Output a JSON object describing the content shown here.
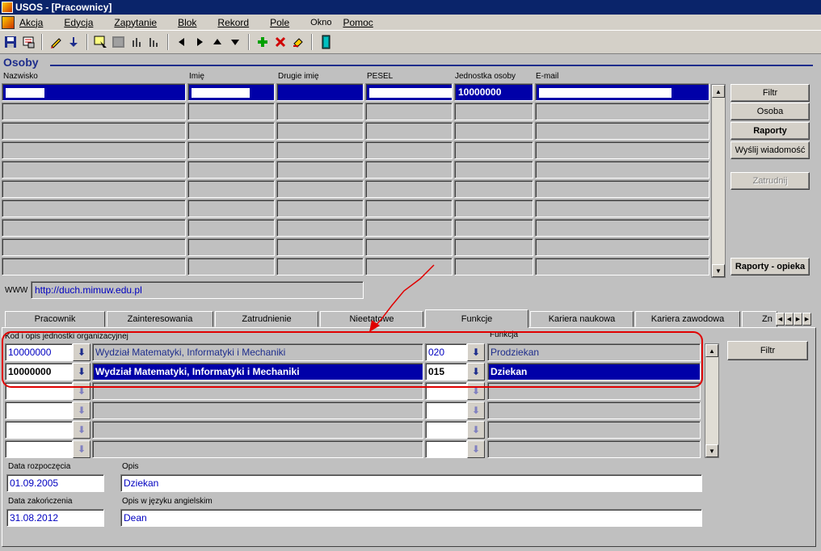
{
  "window": {
    "title": "USOS - [Pracownicy]"
  },
  "menu": [
    "Akcja",
    "Edycja",
    "Zapytanie",
    "Blok",
    "Rekord",
    "Pole",
    "Okno",
    "Pomoc"
  ],
  "toolbar_icons": [
    "save-icon",
    "print-icon",
    "edit-icon",
    "download-icon",
    "enter-query-icon",
    "execute-query-icon",
    "count-icon",
    "stats-icon",
    "first-record-icon",
    "next-record-icon",
    "previous-block-icon",
    "next-block-icon",
    "insert-record-icon",
    "delete-record-icon",
    "clear-record-icon",
    "exit-icon"
  ],
  "osoby": {
    "title": "Osoby",
    "columns": [
      "Nazwisko",
      "Imię",
      "Drugie imię",
      "PESEL",
      "Jednostka osoby",
      "E-mail"
    ],
    "selected_row": {
      "nazwisko": "",
      "imie": "",
      "drugie_imie": "",
      "pesel": "",
      "jednostka": "10000000",
      "email": ""
    },
    "buttons": {
      "filtr": "Filtr",
      "osoba": "Osoba",
      "raporty": "Raporty",
      "wyslij": "Wyślij wiadomość",
      "zatrudnij": "Zatrudnij",
      "raporty_opieka": "Raporty - opieka"
    },
    "www_label": "WWW",
    "www_value": "http://duch.mimuw.edu.pl"
  },
  "tabs": [
    "Pracownik",
    "Zainteresowania",
    "Zatrudnienie",
    "Nieetatowe",
    "Funkcje",
    "Kariera naukowa",
    "Kariera zawodowa",
    "Zn"
  ],
  "active_tab": "Funkcje",
  "funkcje": {
    "label_kod": "Kod i opis jednostki organizacyjnej",
    "label_funkcja": "Funkcja",
    "rows": [
      {
        "kod": "10000000",
        "opis": "Wydział Matematyki, Informatyki i Mechaniki",
        "kod_funkcji": "020",
        "funkcja": "Prodziekan"
      },
      {
        "kod": "10000000",
        "opis": "Wydział Matematyki, Informatyki i Mechaniki",
        "kod_funkcji": "015",
        "funkcja": "Dziekan"
      }
    ],
    "filtr": "Filtr",
    "label_data_rozp": "Data rozpoczęcia",
    "data_rozp": "01.09.2005",
    "label_opis": "Opis",
    "opis": "Dziekan",
    "label_data_zak": "Data zakończenia",
    "data_zak": "31.08.2012",
    "label_opis_en": "Opis w języku angielskim",
    "opis_en": "Dean"
  },
  "annotation_color": "#e00000"
}
